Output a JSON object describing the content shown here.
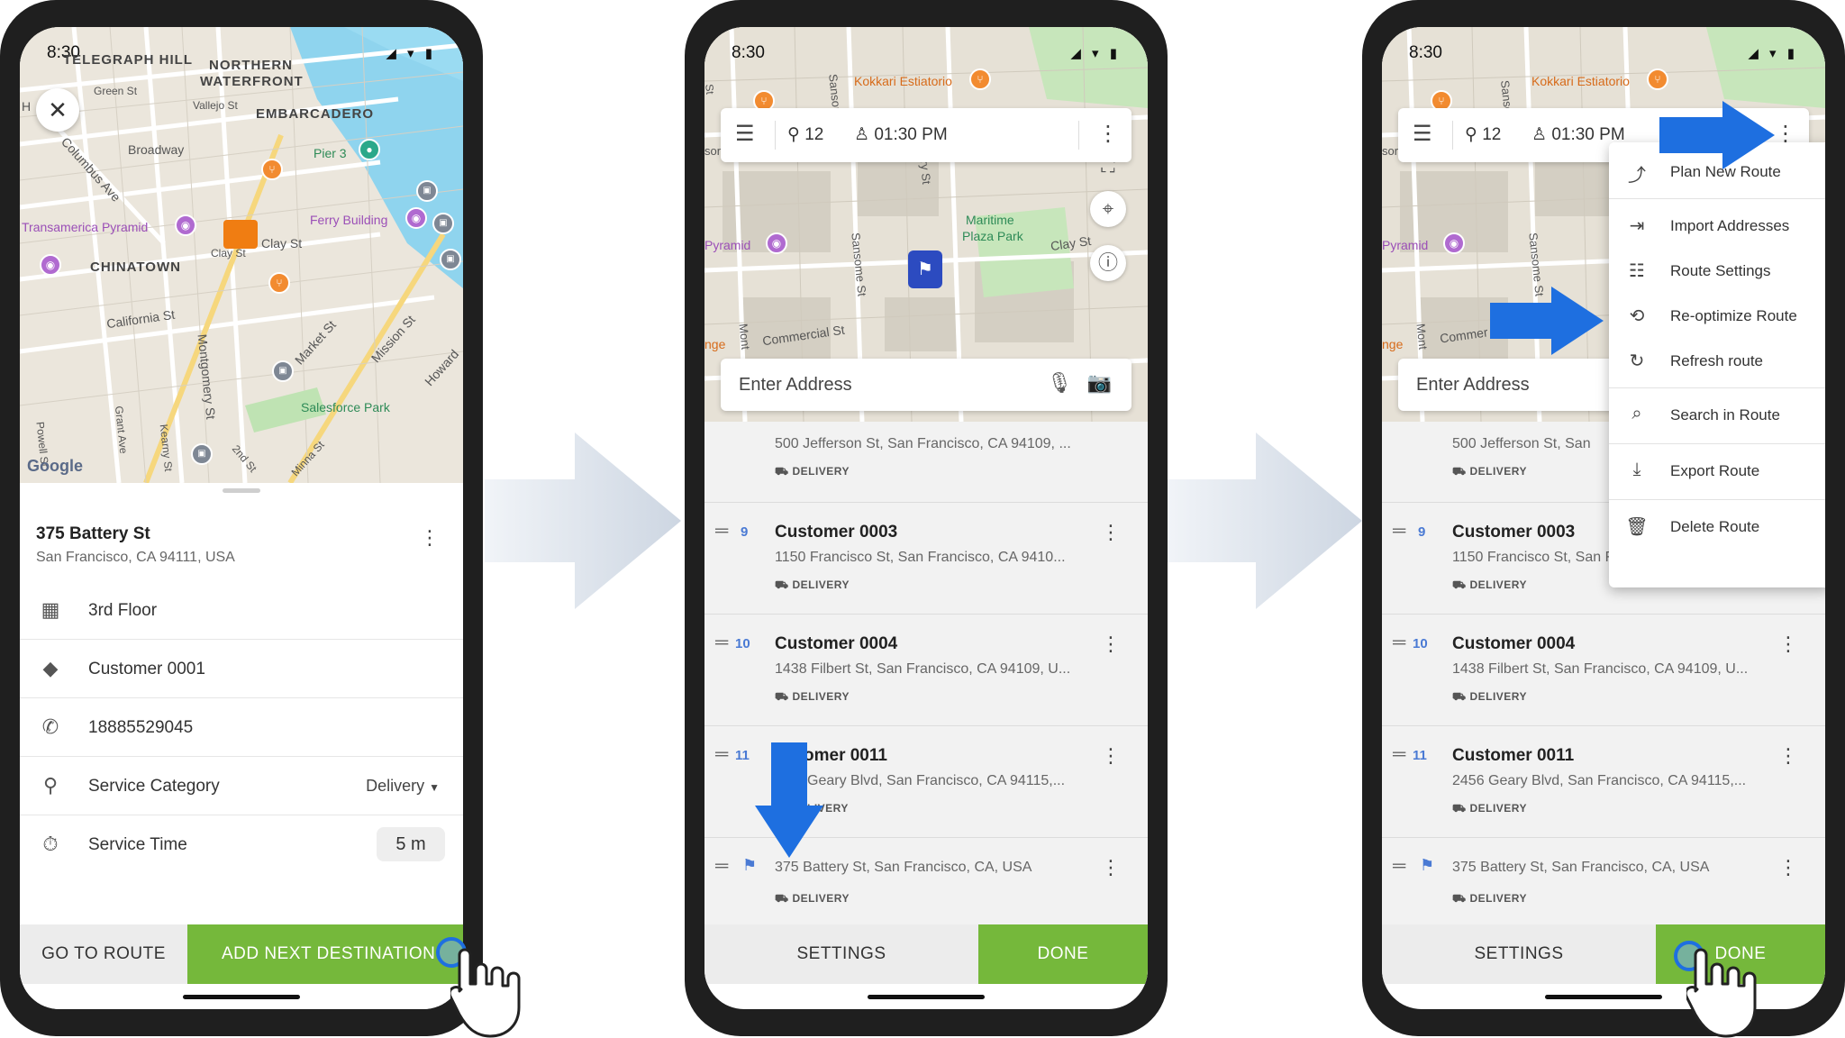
{
  "status_time": "8:30",
  "phone1": {
    "map_labels": {
      "telegraph_hill": "TELEGRAPH HILL",
      "northern": "NORTHERN",
      "waterfront": "WATERFRONT",
      "embarcadero": "EMBARCADERO",
      "green_st": "Green St",
      "vallejo_st": "Vallejo St",
      "broadway": "Broadway",
      "columbus_ave": "Columbus Ave",
      "pier3": "Pier 3",
      "transamerica": "Transamerica Pyramid",
      "ferry_building": "Ferry Building",
      "clay_st": "Clay St",
      "clay_st_small": "Clay St",
      "chinatown": "CHINATOWN",
      "california_st": "California St",
      "montgomery_st": "Montgomery St",
      "market_st": "Market St",
      "mission_st": "Mission St",
      "howard": "Howard",
      "salesforce_park": "Salesforce Park",
      "powell_st": "Powell St",
      "grant_ave": "Grant Ave",
      "kearny_st": "Kearny St",
      "second_st": "2nd St",
      "minna_st": "Minna St",
      "h_letter": "H",
      "google": "Google"
    },
    "address_title": "375 Battery St",
    "address_sub": "San Francisco, CA 94111, USA",
    "rows": {
      "floor": "3rd Floor",
      "customer": "Customer 0001",
      "phone": "18885529045",
      "service_category_label": "Service Category",
      "service_category_value": "Delivery",
      "service_time_label": "Service Time",
      "service_time_value": "5 m"
    },
    "go_to_route": "GO TO ROUTE",
    "add_next": "ADD NEXT DESTINATION"
  },
  "phone2": {
    "topbar": {
      "stops": "12",
      "time": "01:30 PM"
    },
    "map_labels": {
      "kokkari": "Kokkari Estiatorio",
      "sansome_top": "Sansome",
      "battery_st": "ery St",
      "st_left": "St",
      "sor": "sor",
      "maritime": "Maritime",
      "plaza_park": "Plaza Park",
      "pyramid": "Pyramid",
      "sansome_st": "Sansome St",
      "clay_st": "Clay St",
      "commercial_st": "Commercial St",
      "nge": "nge",
      "mont": "Mont"
    },
    "search_placeholder": "Enter Address",
    "stops": {
      "partial_addr": "500 Jefferson St, San Francisco, CA 94109, ...",
      "delivery": "DELIVERY",
      "s9_num": "9",
      "s9_name": "Customer 0003",
      "s9_addr": "1150 Francisco St, San Francisco, CA 9410...",
      "s10_num": "10",
      "s10_name": "Customer 0004",
      "s10_addr": "1438 Filbert St, San Francisco, CA 94109, U...",
      "s11_num": "11",
      "s11_name": "omer 0011",
      "s11_addr": "Geary Blvd, San Francisco, CA 94115,...",
      "s11_tag": "LIVERY",
      "final_addr": "375 Battery St, San Francisco, CA, USA"
    },
    "settings": "SETTINGS",
    "done": "DONE"
  },
  "phone3": {
    "topbar": {
      "stops": "12",
      "time": "01:30 PM"
    },
    "map_labels": {
      "kokkari": "Kokkari Estiatorio",
      "sansome_top": "Sanso",
      "sor": "sor",
      "pyramid": "Pyramid",
      "sansome_st": "Sansome St",
      "commer": "Commer",
      "nge": "nge",
      "mont": "Mont"
    },
    "search_placeholder": "Enter Address",
    "menu": {
      "plan_new_route": "Plan New Route",
      "import_addresses": "Import Addresses",
      "route_settings": "Route Settings",
      "reoptimize_route": "Re-optimize Route",
      "refresh_route": "Refresh route",
      "search_in_route": "Search in Route",
      "export_route": "Export Route",
      "delete_route": "Delete Route"
    },
    "stops": {
      "partial_addr": "500 Jefferson St, San",
      "delivery": "DELIVERY",
      "s9_num": "9",
      "s9_name": "Customer 0003",
      "s9_addr": "1150 Francisco St, San Francisco, CA 9410...",
      "s10_num": "10",
      "s10_name": "Customer 0004",
      "s10_addr": "1438 Filbert St, San Francisco, CA 94109, U...",
      "s11_num": "11",
      "s11_name": "Customer 0011",
      "s11_addr": "2456 Geary Blvd, San Francisco, CA 94115,...",
      "final_addr": "375 Battery St, San Francisco, CA, USA"
    },
    "settings": "SETTINGS",
    "done": "DONE"
  },
  "colors": {
    "accent_green": "#75b83b",
    "accent_blue": "#1e6fe0",
    "arrow_gray": "#dde3ec",
    "flag_blue": "#2c4bc0"
  }
}
